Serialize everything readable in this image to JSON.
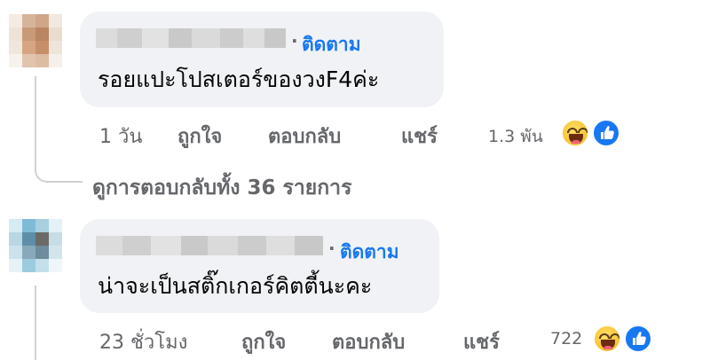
{
  "comments": [
    {
      "follow_label": "ติดตาม",
      "separator": "·",
      "text": "รอยแปะโปสเตอร์ของวงF4ค่ะ",
      "time": "1 วัน",
      "like_label": "ถูกใจ",
      "reply_label": "ตอบกลับ",
      "share_label": "แชร์",
      "reaction_count": "1.3 พัน",
      "view_replies": "ดูการตอบกลับทั้ง 36 รายการ"
    },
    {
      "follow_label": "ติดตาม",
      "separator": "·",
      "text": "น่าจะเป็นสติ๊กเกอร์คิตตี้นะคะ",
      "time": "23 ชั่วโมง",
      "like_label": "ถูกใจ",
      "reply_label": "ตอบกลับ",
      "share_label": "แชร์",
      "reaction_count": "722"
    }
  ],
  "icons": {
    "reaction_1": "laughing-emoji-icon",
    "reaction_2": "thumbs-up-like-icon"
  },
  "colors": {
    "follow": "#1877f2",
    "meta": "#65676b",
    "bubble": "#f0f2f5",
    "like_badge": "#1877f2"
  }
}
